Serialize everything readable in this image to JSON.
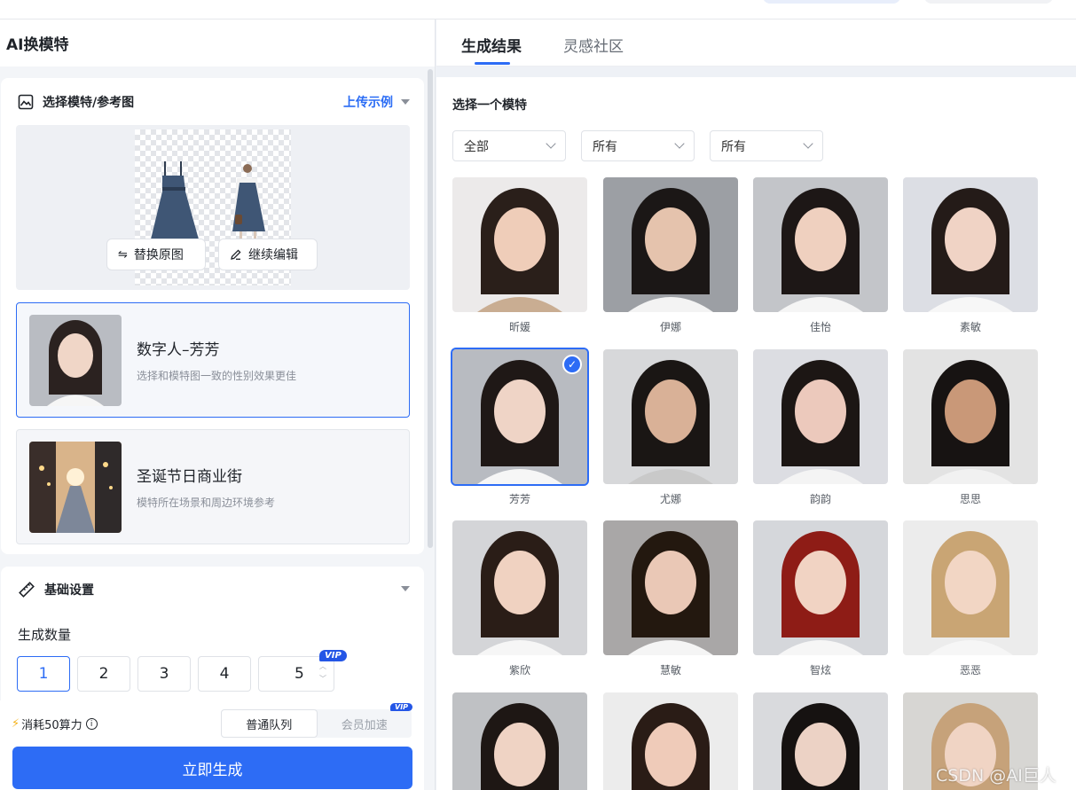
{
  "left": {
    "title": "AI换模特",
    "reference_card": {
      "title": "选择模特/参考图",
      "action": "上传示例",
      "replace_label": "替换原图",
      "edit_label": "继续编辑",
      "model_item": {
        "name": "数字人–芳芳",
        "desc": "选择和模特图一致的性别效果更佳"
      },
      "scene_item": {
        "name": "圣诞节日商业街",
        "desc": "模特所在场景和周边环境参考"
      }
    },
    "settings": {
      "title": "基础设置",
      "count_label": "生成数量",
      "counts": [
        "1",
        "2",
        "3",
        "4",
        "5"
      ],
      "selected_count": "1",
      "vip_badge": "VIP"
    },
    "footer": {
      "cost_text": "消耗50算力",
      "queue_normal": "普通队列",
      "queue_vip": "会员加速",
      "vip_badge": "VIP",
      "generate_label": "立即生成"
    }
  },
  "right": {
    "tabs": [
      "生成结果",
      "灵感社区"
    ],
    "active_tab": "生成结果",
    "section_title": "选择一个模特",
    "filters": [
      "全部",
      "所有",
      "所有"
    ],
    "models": [
      "昕媛",
      "伊娜",
      "佳怡",
      "素敏",
      "芳芳",
      "尤娜",
      "韵韵",
      "思思",
      "紫欣",
      "慧敏",
      "智炫",
      "恶恶",
      "",
      "",
      "",
      ""
    ],
    "selected_model": "芳芳"
  },
  "watermark": "CSDN @AI巨人",
  "colors": {
    "accent": "#2d6cf5",
    "vip": "#2456e6",
    "panel_bg": "#eef1f6"
  }
}
